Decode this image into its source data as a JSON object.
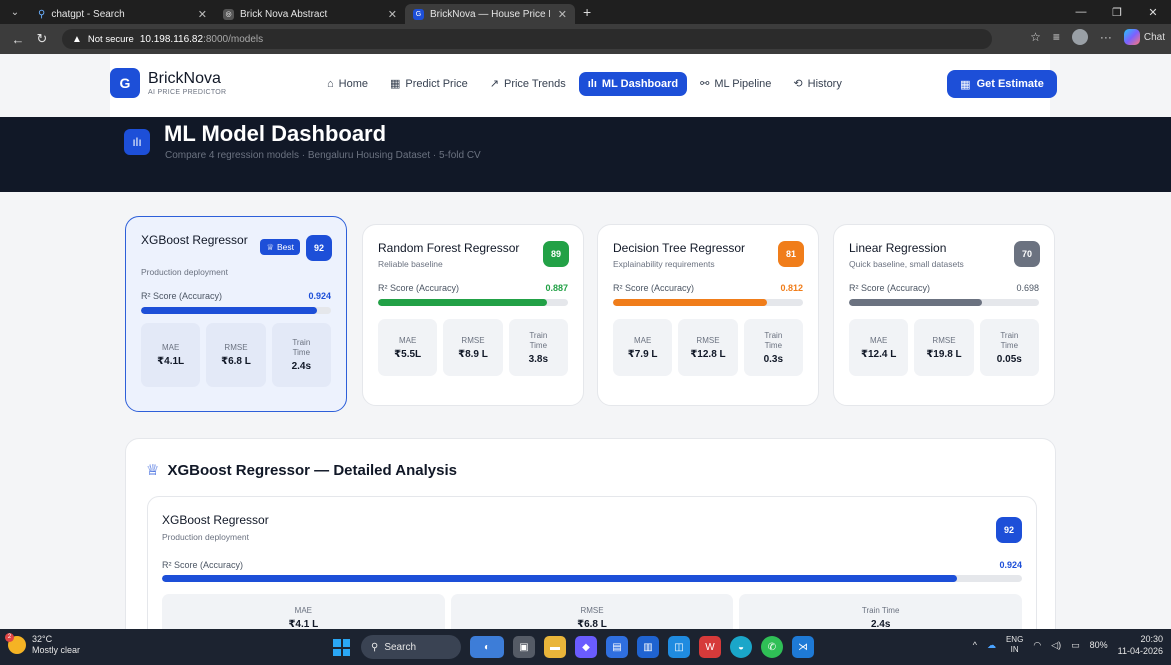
{
  "browser": {
    "tabs": [
      {
        "label": "chatgpt - Search"
      },
      {
        "label": "Brick Nova Abstract"
      },
      {
        "label": "BrickNova — House Price Predictio"
      }
    ],
    "address": {
      "security": "Not secure",
      "host": "10.198.116.82",
      "path": ":8000/models"
    },
    "chat_label": "Chat"
  },
  "brand": {
    "name": "BrickNova",
    "tagline": "AI PRICE PREDICTOR",
    "logo_letter": "G"
  },
  "nav": {
    "items": [
      {
        "label": "Home",
        "icon": "home-icon"
      },
      {
        "label": "Predict Price",
        "icon": "calculator-icon"
      },
      {
        "label": "Price Trends",
        "icon": "trend-icon"
      },
      {
        "label": "ML Dashboard",
        "icon": "bar-chart-icon",
        "active": true
      },
      {
        "label": "ML Pipeline",
        "icon": "pipeline-icon"
      },
      {
        "label": "History",
        "icon": "history-icon"
      }
    ],
    "cta": "Get Estimate"
  },
  "hero": {
    "title": "ML Model Dashboard",
    "subtitle": "Compare 4 regression models · Bengaluru Housing Dataset · 5-fold CV"
  },
  "models": [
    {
      "name": "XGBoost Regressor",
      "desc": "Production deployment",
      "score": "92",
      "badge": "Best",
      "r2_label": "R² Score (Accuracy)",
      "r2": "0.924",
      "r2_fraction": 0.924,
      "color": "#1d4fd8",
      "mae_label": "MAE",
      "mae": "₹4.1L",
      "rmse_label": "RMSE",
      "rmse": "₹6.8 L",
      "train_label": "Train Time",
      "train": "2.4s"
    },
    {
      "name": "Random Forest Regressor",
      "desc": "Reliable baseline",
      "score": "89",
      "r2_label": "R² Score (Accuracy)",
      "r2": "0.887",
      "r2_fraction": 0.887,
      "color": "#22a146",
      "mae_label": "MAE",
      "mae": "₹5.5L",
      "rmse_label": "RMSE",
      "rmse": "₹8.9 L",
      "train_label": "Train Time",
      "train": "3.8s"
    },
    {
      "name": "Decision Tree Regressor",
      "desc": "Explainability requirements",
      "score": "81",
      "r2_label": "R² Score (Accuracy)",
      "r2": "0.812",
      "r2_fraction": 0.812,
      "color": "#f07d1a",
      "mae_label": "MAE",
      "mae": "₹7.9 L",
      "rmse_label": "RMSE",
      "rmse": "₹12.8 L",
      "train_label": "Train Time",
      "train": "0.3s"
    },
    {
      "name": "Linear Regression",
      "desc": "Quick baseline, small datasets",
      "score": "70",
      "r2_label": "R² Score (Accuracy)",
      "r2": "0.698",
      "r2_fraction": 0.698,
      "color": "#6b7280",
      "mae_label": "MAE",
      "mae": "₹12.4 L",
      "rmse_label": "RMSE",
      "rmse": "₹19.8 L",
      "train_label": "Train Time",
      "train": "0.05s"
    }
  ],
  "detail": {
    "title": "XGBoost Regressor — Detailed Analysis",
    "name": "XGBoost Regressor",
    "desc": "Production deployment",
    "score": "92",
    "r2_label": "R² Score (Accuracy)",
    "r2": "0.924",
    "r2_fraction": 0.924,
    "metrics": [
      {
        "label": "MAE",
        "value": "₹4.1 L"
      },
      {
        "label": "RMSE",
        "value": "₹6.8 L"
      },
      {
        "label": "Train Time",
        "value": "2.4s"
      }
    ]
  },
  "taskbar": {
    "weather_temp": "32°C",
    "weather_desc": "Mostly clear",
    "weather_badge": "2",
    "search": "Search",
    "lang1": "ENG",
    "lang2": "IN",
    "battery": "80%",
    "time": "20:30",
    "date": "11-04-2026"
  },
  "colors": {
    "accent": "#1d4fd8",
    "hero_bg": "#111827",
    "green": "#22a146",
    "orange": "#f07d1a",
    "gray": "#6b7280"
  }
}
